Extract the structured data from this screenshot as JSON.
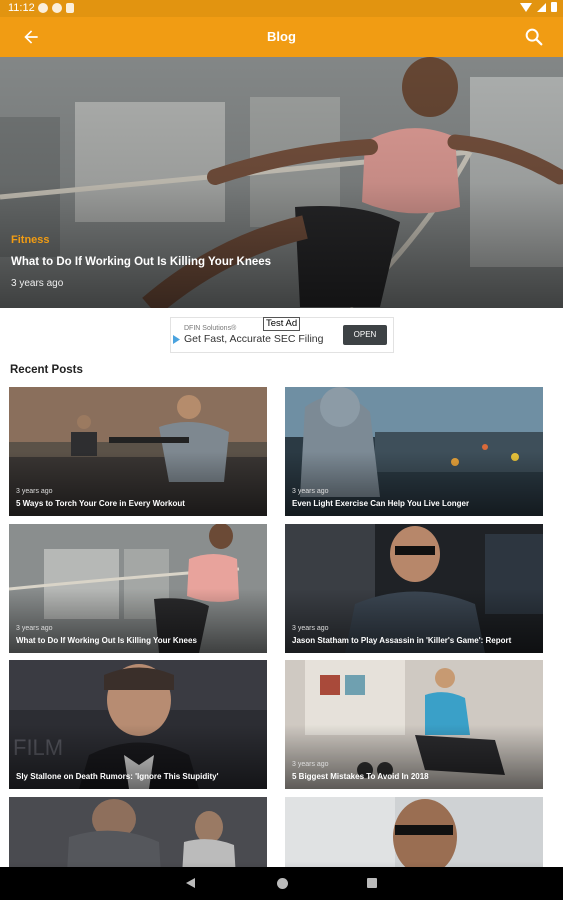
{
  "status_bar": {
    "time": "11:12"
  },
  "app_bar": {
    "title": "Blog"
  },
  "featured": {
    "category": "Fitness",
    "title": "What to Do If Working Out Is Killing Your Knees",
    "date": "3 years ago"
  },
  "ad": {
    "badge": "Test Ad",
    "source": "DFIN Solutions®",
    "text": "Get Fast, Accurate SEC Filing",
    "button": "OPEN"
  },
  "recent": {
    "heading": "Recent Posts",
    "posts": [
      {
        "date": "3 years ago",
        "title": "5 Ways to Torch Your Core in Every Workout"
      },
      {
        "date": "3 years ago",
        "title": "Even Light Exercise Can Help You Live Longer"
      },
      {
        "date": "3 years ago",
        "title": "What to Do If Working Out Is Killing Your Knees"
      },
      {
        "date": "3 years ago",
        "title": "Jason Statham to Play Assassin in 'Killer's Game': Report"
      },
      {
        "date": "",
        "title": "Sly Stallone on Death Rumors: 'Ignore This Stupidity'"
      },
      {
        "date": "3 years ago",
        "title": "5 Biggest Mistakes To Avoid In 2018"
      },
      {
        "date": "",
        "title": ""
      },
      {
        "date": "",
        "title": ""
      }
    ]
  },
  "colors": {
    "primary": "#f19c13",
    "status_bar": "#e29410",
    "category": "#f19c13"
  }
}
